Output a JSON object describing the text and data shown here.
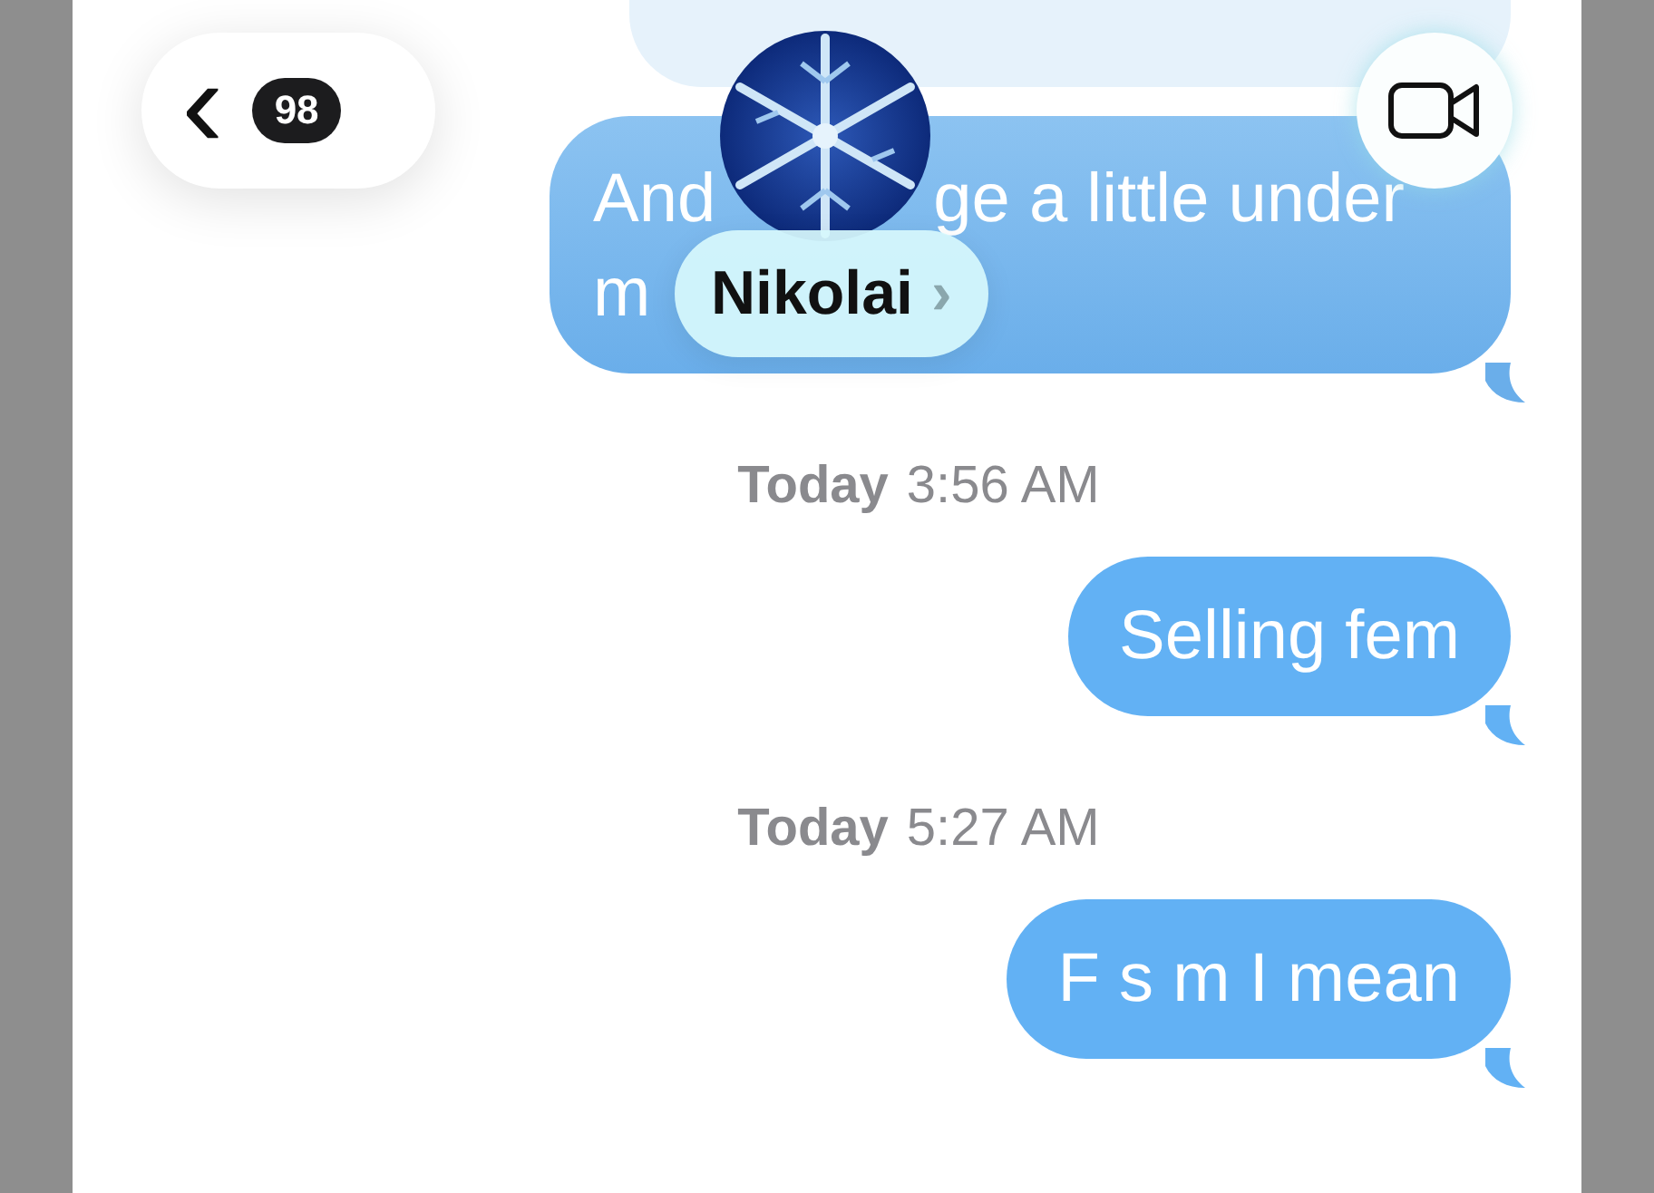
{
  "header": {
    "back_label": "‹",
    "unread_count": "98",
    "contact": {
      "name": "Nikolai",
      "chevron": "›"
    }
  },
  "messages": [
    {
      "kind": "cut_bubble"
    },
    {
      "kind": "bubble",
      "faded": true,
      "lines": [
        [
          "And",
          "ge a little under"
        ],
        [
          "m"
        ]
      ]
    },
    {
      "kind": "time",
      "day": "Today",
      "time": "3:56 AM"
    },
    {
      "kind": "bubble",
      "faded": false,
      "lines": [
        [
          "Selling fem"
        ]
      ]
    },
    {
      "kind": "time",
      "day": "Today",
      "time": "5:27 AM"
    },
    {
      "kind": "bubble",
      "faded": false,
      "lines": [
        [
          "F s m I mean"
        ]
      ]
    }
  ]
}
